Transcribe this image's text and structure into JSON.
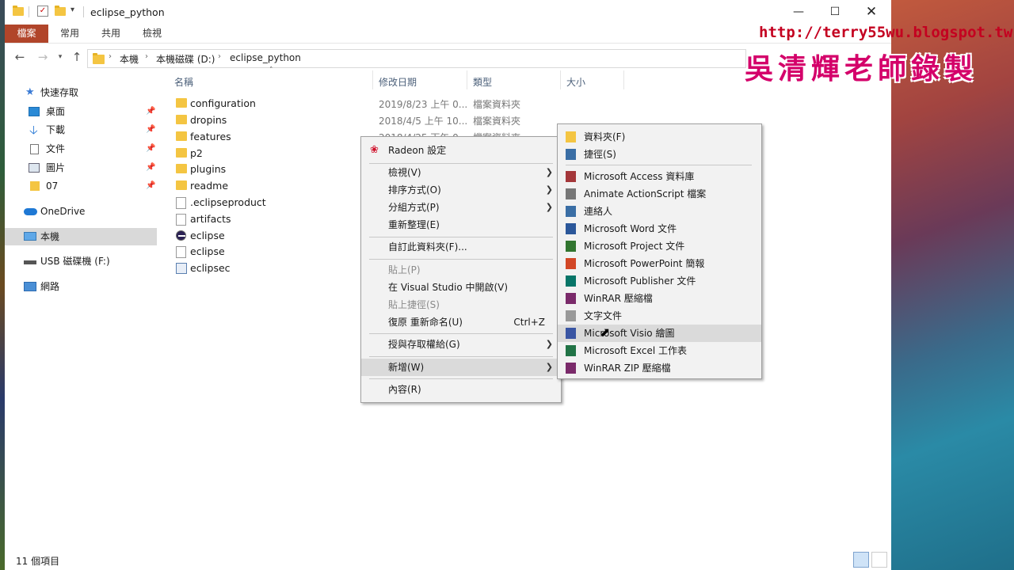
{
  "window": {
    "title": "eclipse_python",
    "controls": [
      "minimize",
      "maximize",
      "close"
    ]
  },
  "ribbon": {
    "tabs": [
      "檔案",
      "常用",
      "共用",
      "檢視"
    ]
  },
  "address": {
    "crumbs": [
      "本機",
      "本機磁碟 (D:)",
      "eclipse_python"
    ]
  },
  "nav": {
    "quick_access": "快速存取",
    "items": [
      {
        "label": "桌面",
        "icon": "desktop-icon",
        "pinned": true
      },
      {
        "label": "下載",
        "icon": "download-icon",
        "pinned": true
      },
      {
        "label": "文件",
        "icon": "document-icon",
        "pinned": true
      },
      {
        "label": "圖片",
        "icon": "picture-icon",
        "pinned": true
      },
      {
        "label": "07",
        "icon": "folder-icon",
        "pinned": true
      }
    ],
    "onedrive": "OneDrive",
    "this_pc": "本機",
    "usb": "USB 磁碟機 (F:)",
    "network": "網路"
  },
  "columns": {
    "name": "名稱",
    "date": "修改日期",
    "type": "類型",
    "size": "大小"
  },
  "files": [
    {
      "name": "configuration",
      "date": "2019/8/23 上午 0...",
      "type": "檔案資料夾",
      "icon": "folder"
    },
    {
      "name": "dropins",
      "date": "2018/4/5 上午 10...",
      "type": "檔案資料夾",
      "icon": "folder"
    },
    {
      "name": "features",
      "date": "2018/4/25 下午 0...",
      "type": "檔案資料夾",
      "icon": "folder"
    },
    {
      "name": "p2",
      "date": "",
      "type": "",
      "icon": "folder"
    },
    {
      "name": "plugins",
      "date": "",
      "type": "",
      "icon": "folder"
    },
    {
      "name": "readme",
      "date": "",
      "type": "",
      "icon": "folder"
    },
    {
      "name": ".eclipseproduct",
      "date": "",
      "type": "",
      "icon": "doc"
    },
    {
      "name": "artifacts",
      "date": "",
      "type": "",
      "icon": "doc"
    },
    {
      "name": "eclipse",
      "date": "",
      "type": "",
      "icon": "eclipse"
    },
    {
      "name": "eclipse",
      "date": "",
      "type": "",
      "icon": "doc"
    },
    {
      "name": "eclipsec",
      "date": "",
      "type": "",
      "icon": "ini"
    }
  ],
  "status": {
    "count": "11 個項目"
  },
  "context_menu": {
    "radeon": "Radeon 設定",
    "view": "檢視(V)",
    "sort": "排序方式(O)",
    "group": "分組方式(P)",
    "refresh": "重新整理(E)",
    "customize": "自訂此資料夾(F)...",
    "paste": "貼上(P)",
    "open_vs": "在 Visual Studio 中開啟(V)",
    "paste_shortcut": "貼上捷徑(S)",
    "undo_rename": "復原 重新命名(U)",
    "undo_shortcut": "Ctrl+Z",
    "give_access": "授與存取權給(G)",
    "new": "新增(W)",
    "properties": "內容(R)"
  },
  "submenu": {
    "items": [
      {
        "label": "資料夾(F)",
        "icon": "folder-icon",
        "color": "#f4c542"
      },
      {
        "label": "捷徑(S)",
        "icon": "shortcut-icon",
        "color": "#3a6ea5"
      },
      {
        "label": "Microsoft Access 資料庫",
        "icon": "access-icon",
        "color": "#a4373a"
      },
      {
        "label": "Animate ActionScript 檔案",
        "icon": "actionscript-icon",
        "color": "#777777"
      },
      {
        "label": "連絡人",
        "icon": "contact-icon",
        "color": "#3a6ea5"
      },
      {
        "label": "Microsoft Word 文件",
        "icon": "word-icon",
        "color": "#2b579a"
      },
      {
        "label": "Microsoft Project 文件",
        "icon": "project-icon",
        "color": "#31752f"
      },
      {
        "label": "Microsoft PowerPoint 簡報",
        "icon": "powerpoint-icon",
        "color": "#d24726"
      },
      {
        "label": "Microsoft Publisher 文件",
        "icon": "publisher-icon",
        "color": "#077568"
      },
      {
        "label": "WinRAR 壓縮檔",
        "icon": "winrar-icon",
        "color": "#7a2a6a"
      },
      {
        "label": "文字文件",
        "icon": "text-icon",
        "color": "#999999"
      },
      {
        "label": "Microsoft Visio 繪圖",
        "icon": "visio-icon",
        "color": "#3955a3"
      },
      {
        "label": "Microsoft Excel 工作表",
        "icon": "excel-icon",
        "color": "#217346"
      },
      {
        "label": "WinRAR ZIP 壓縮檔",
        "icon": "winrar-zip-icon",
        "color": "#7a2a6a"
      }
    ]
  },
  "watermark": {
    "url": "http://terry55wu.blogspot.tw",
    "name": "吳清輝老師錄製"
  }
}
